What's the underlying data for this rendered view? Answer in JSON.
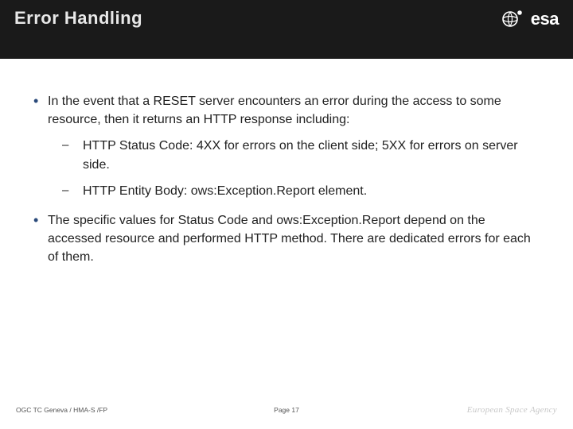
{
  "header": {
    "title": "Error Handling",
    "logo_text": "esa"
  },
  "content": {
    "bullets": [
      {
        "text": "In the event that a RESET server encounters an error during the access to some resource, then it returns an HTTP response including:",
        "sub": [
          "HTTP Status Code: 4XX for errors on the client side; 5XX for errors on server side.",
          "HTTP Entity Body: ows:Exception.Report element."
        ]
      },
      {
        "text": "The specific values for Status Code and ows:Exception.Report depend on the accessed resource and performed HTTP method. There are dedicated errors for each of them.",
        "sub": []
      }
    ]
  },
  "footer": {
    "left": "OGC TC Geneva / HMA-S /FP",
    "center": "Page 17",
    "right": "European Space Agency"
  }
}
